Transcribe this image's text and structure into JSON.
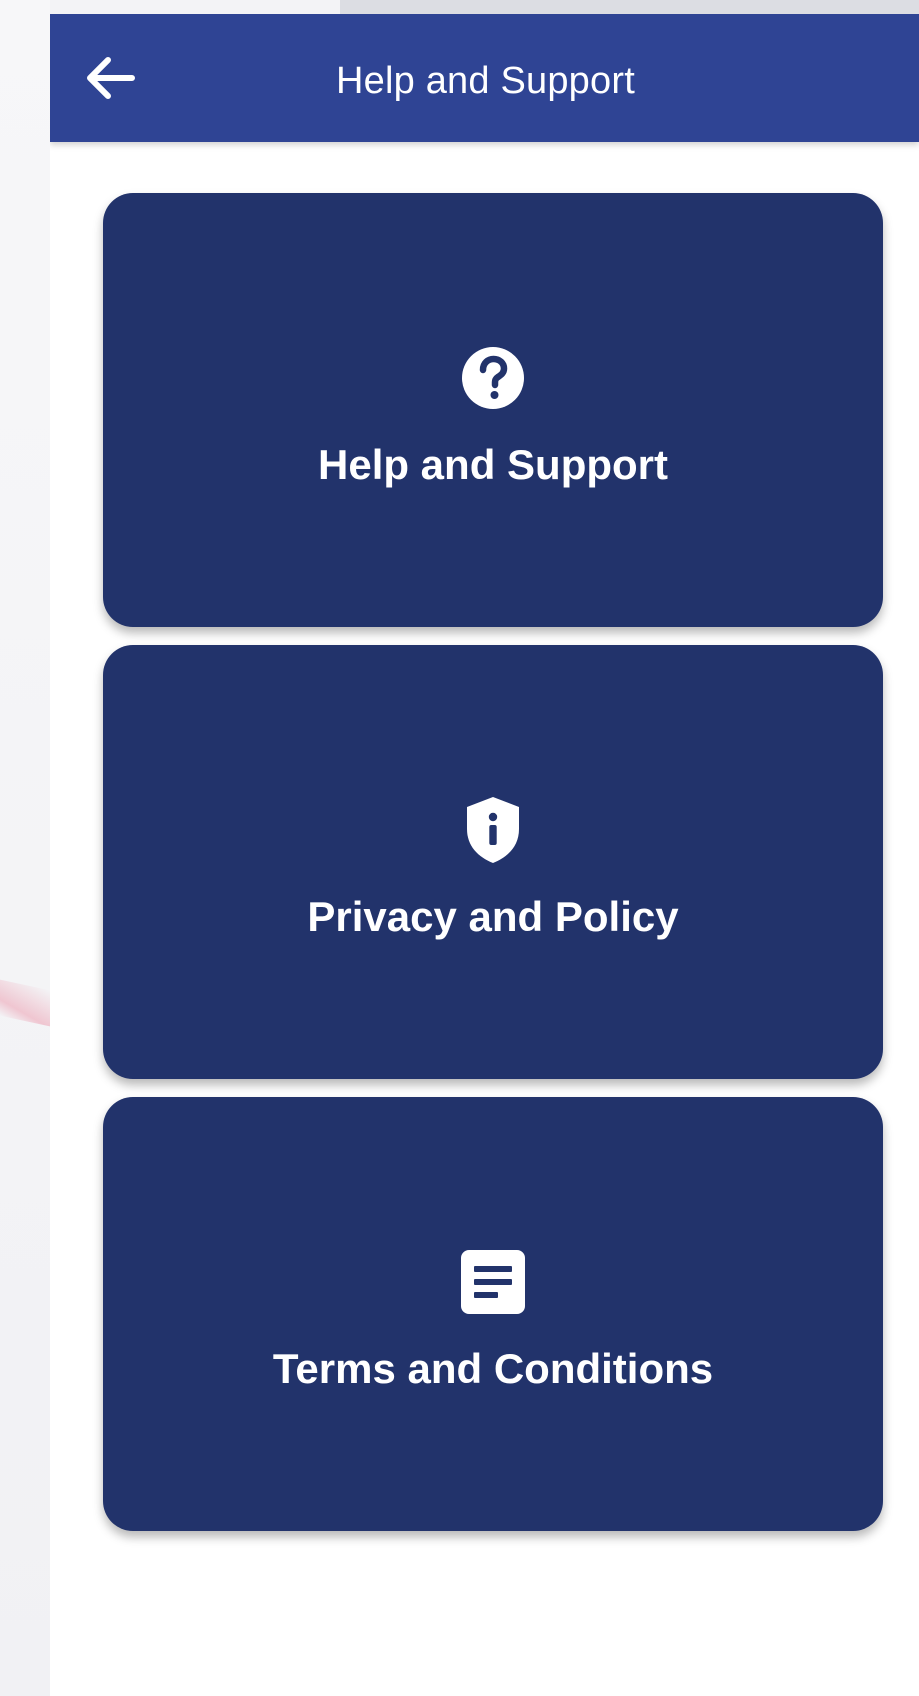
{
  "app_bar": {
    "title": "Help and Support",
    "back_icon": "arrow-left-icon"
  },
  "menu": {
    "items": [
      {
        "label": "Help and Support",
        "icon": "help-circle-icon"
      },
      {
        "label": "Privacy and Policy",
        "icon": "shield-info-icon"
      },
      {
        "label": "Terms and Conditions",
        "icon": "document-icon"
      }
    ]
  },
  "colors": {
    "app_bar": "#2f4494",
    "card": "#22336b",
    "text": "#ffffff",
    "background": "#ffffff"
  }
}
